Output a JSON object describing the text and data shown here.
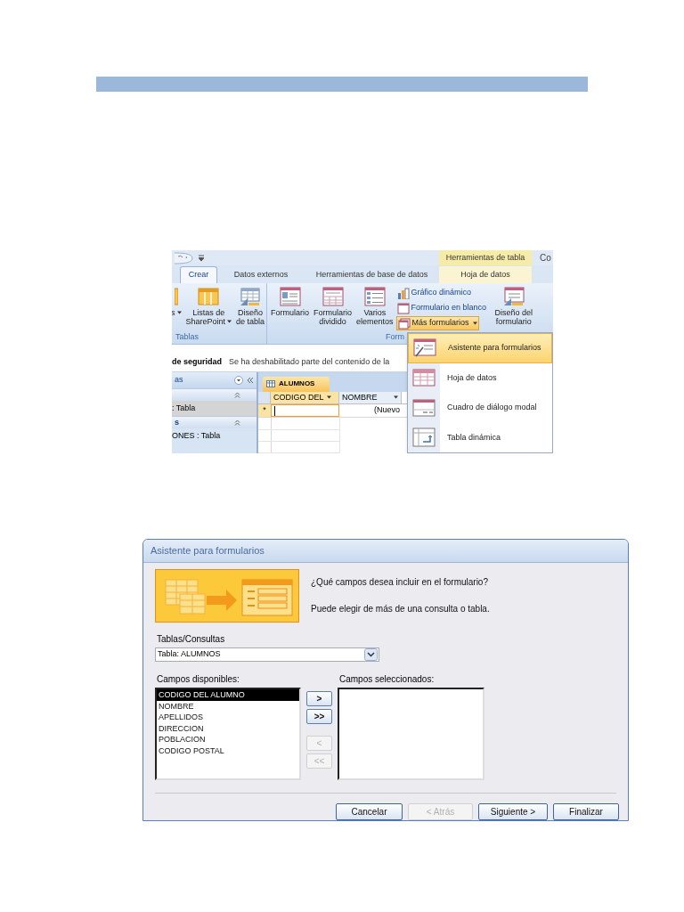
{
  "ribbon_screenshot": {
    "contextual_tab_group": "Herramientas de tabla",
    "cut_tab": "Co",
    "tabs": [
      {
        "label": "Crear",
        "selected": true
      },
      {
        "label": "Datos externos",
        "selected": false
      },
      {
        "label": "Herramientas de base de datos",
        "selected": false
      },
      {
        "label": "Hoja de datos",
        "selected": false
      }
    ],
    "groups": [
      {
        "label": "Tablas",
        "large_buttons": [
          {
            "kind": "cut",
            "lines": [
              "s"
            ],
            "dropdown": true
          },
          {
            "kind": "list",
            "lines": [
              "Listas de",
              "SharePoint"
            ],
            "dropdown": true
          },
          {
            "kind": "table-design",
            "lines": [
              "Diseño",
              "de tabla"
            ],
            "dropdown": false
          }
        ]
      },
      {
        "label": "Form",
        "large_buttons": [
          {
            "kind": "form",
            "lines": [
              "Formulario"
            ],
            "dropdown": false
          },
          {
            "kind": "split-form",
            "lines": [
              "Formulario",
              "dividido"
            ],
            "dropdown": false
          },
          {
            "kind": "multi",
            "lines": [
              "Varios",
              "elementos"
            ],
            "dropdown": false
          }
        ],
        "small_buttons": [
          {
            "kind": "chart",
            "label": "Gráfico dinámico",
            "dropdown": false,
            "selected": false
          },
          {
            "kind": "blank",
            "label": "Formulario en blanco",
            "dropdown": false,
            "selected": false
          },
          {
            "kind": "more",
            "label": "Más formularios",
            "dropdown": true,
            "selected": true
          }
        ],
        "trailing_buttons": [
          {
            "kind": "form-design",
            "lines": [
              "Diseño del",
              "formulario"
            ],
            "dropdown": false
          }
        ]
      }
    ],
    "message_bar": {
      "title": "de seguridad",
      "text": "Se ha deshabilitado parte del contenido de la"
    },
    "navigation_pane": {
      "header": "as",
      "sections": [
        {
          "items": [
            {
              "label": ": Tabla",
              "selected": true
            }
          ]
        },
        {
          "header": "s",
          "items": [
            {
              "label": "ONES : Tabla",
              "selected": false
            }
          ]
        }
      ]
    },
    "datasheet": {
      "tab": "ALUMNOS",
      "columns": [
        "CODIGO DEL",
        "NOMBRE"
      ],
      "new_row_marker": "*",
      "new_row_value": "(Nuevo"
    },
    "dropdown_menu": {
      "items": [
        {
          "kind": "wizard",
          "label": "Asistente para formularios",
          "selected": true
        },
        {
          "kind": "datasheet",
          "label": "Hoja de datos",
          "selected": false
        },
        {
          "kind": "modal",
          "label": "Cuadro de diálogo modal",
          "selected": false
        },
        {
          "kind": "pivot",
          "label": "Tabla dinámica",
          "selected": false
        }
      ]
    }
  },
  "wizard_dialog": {
    "title": "Asistente para formularios",
    "prompt": "¿Qué campos desea incluir en el formulario?",
    "hint": "Puede elegir de más de una consulta o tabla.",
    "tables_label": "Tablas/Consultas",
    "tables_value": "Tabla: ALUMNOS",
    "available_label": "Campos disponibles:",
    "selected_label": "Campos seleccionados:",
    "available_fields": [
      {
        "label": "CODIGO DEL ALUMNO",
        "selected": true
      },
      {
        "label": "NOMBRE",
        "selected": false
      },
      {
        "label": "APELLIDOS",
        "selected": false
      },
      {
        "label": "DIRECCION",
        "selected": false
      },
      {
        "label": "POBLACION",
        "selected": false
      },
      {
        "label": "CODIGO POSTAL",
        "selected": false
      }
    ],
    "move_buttons": [
      {
        "label": ">",
        "disabled": false
      },
      {
        "label": ">>",
        "disabled": false
      },
      {
        "label": "<",
        "disabled": true
      },
      {
        "label": "<<",
        "disabled": true
      }
    ],
    "buttons": [
      {
        "label": "Cancelar",
        "disabled": false
      },
      {
        "label": "< Atrás",
        "disabled": true
      },
      {
        "label": "Siguiente >",
        "disabled": false
      },
      {
        "label": "Finalizar",
        "disabled": false
      }
    ]
  }
}
